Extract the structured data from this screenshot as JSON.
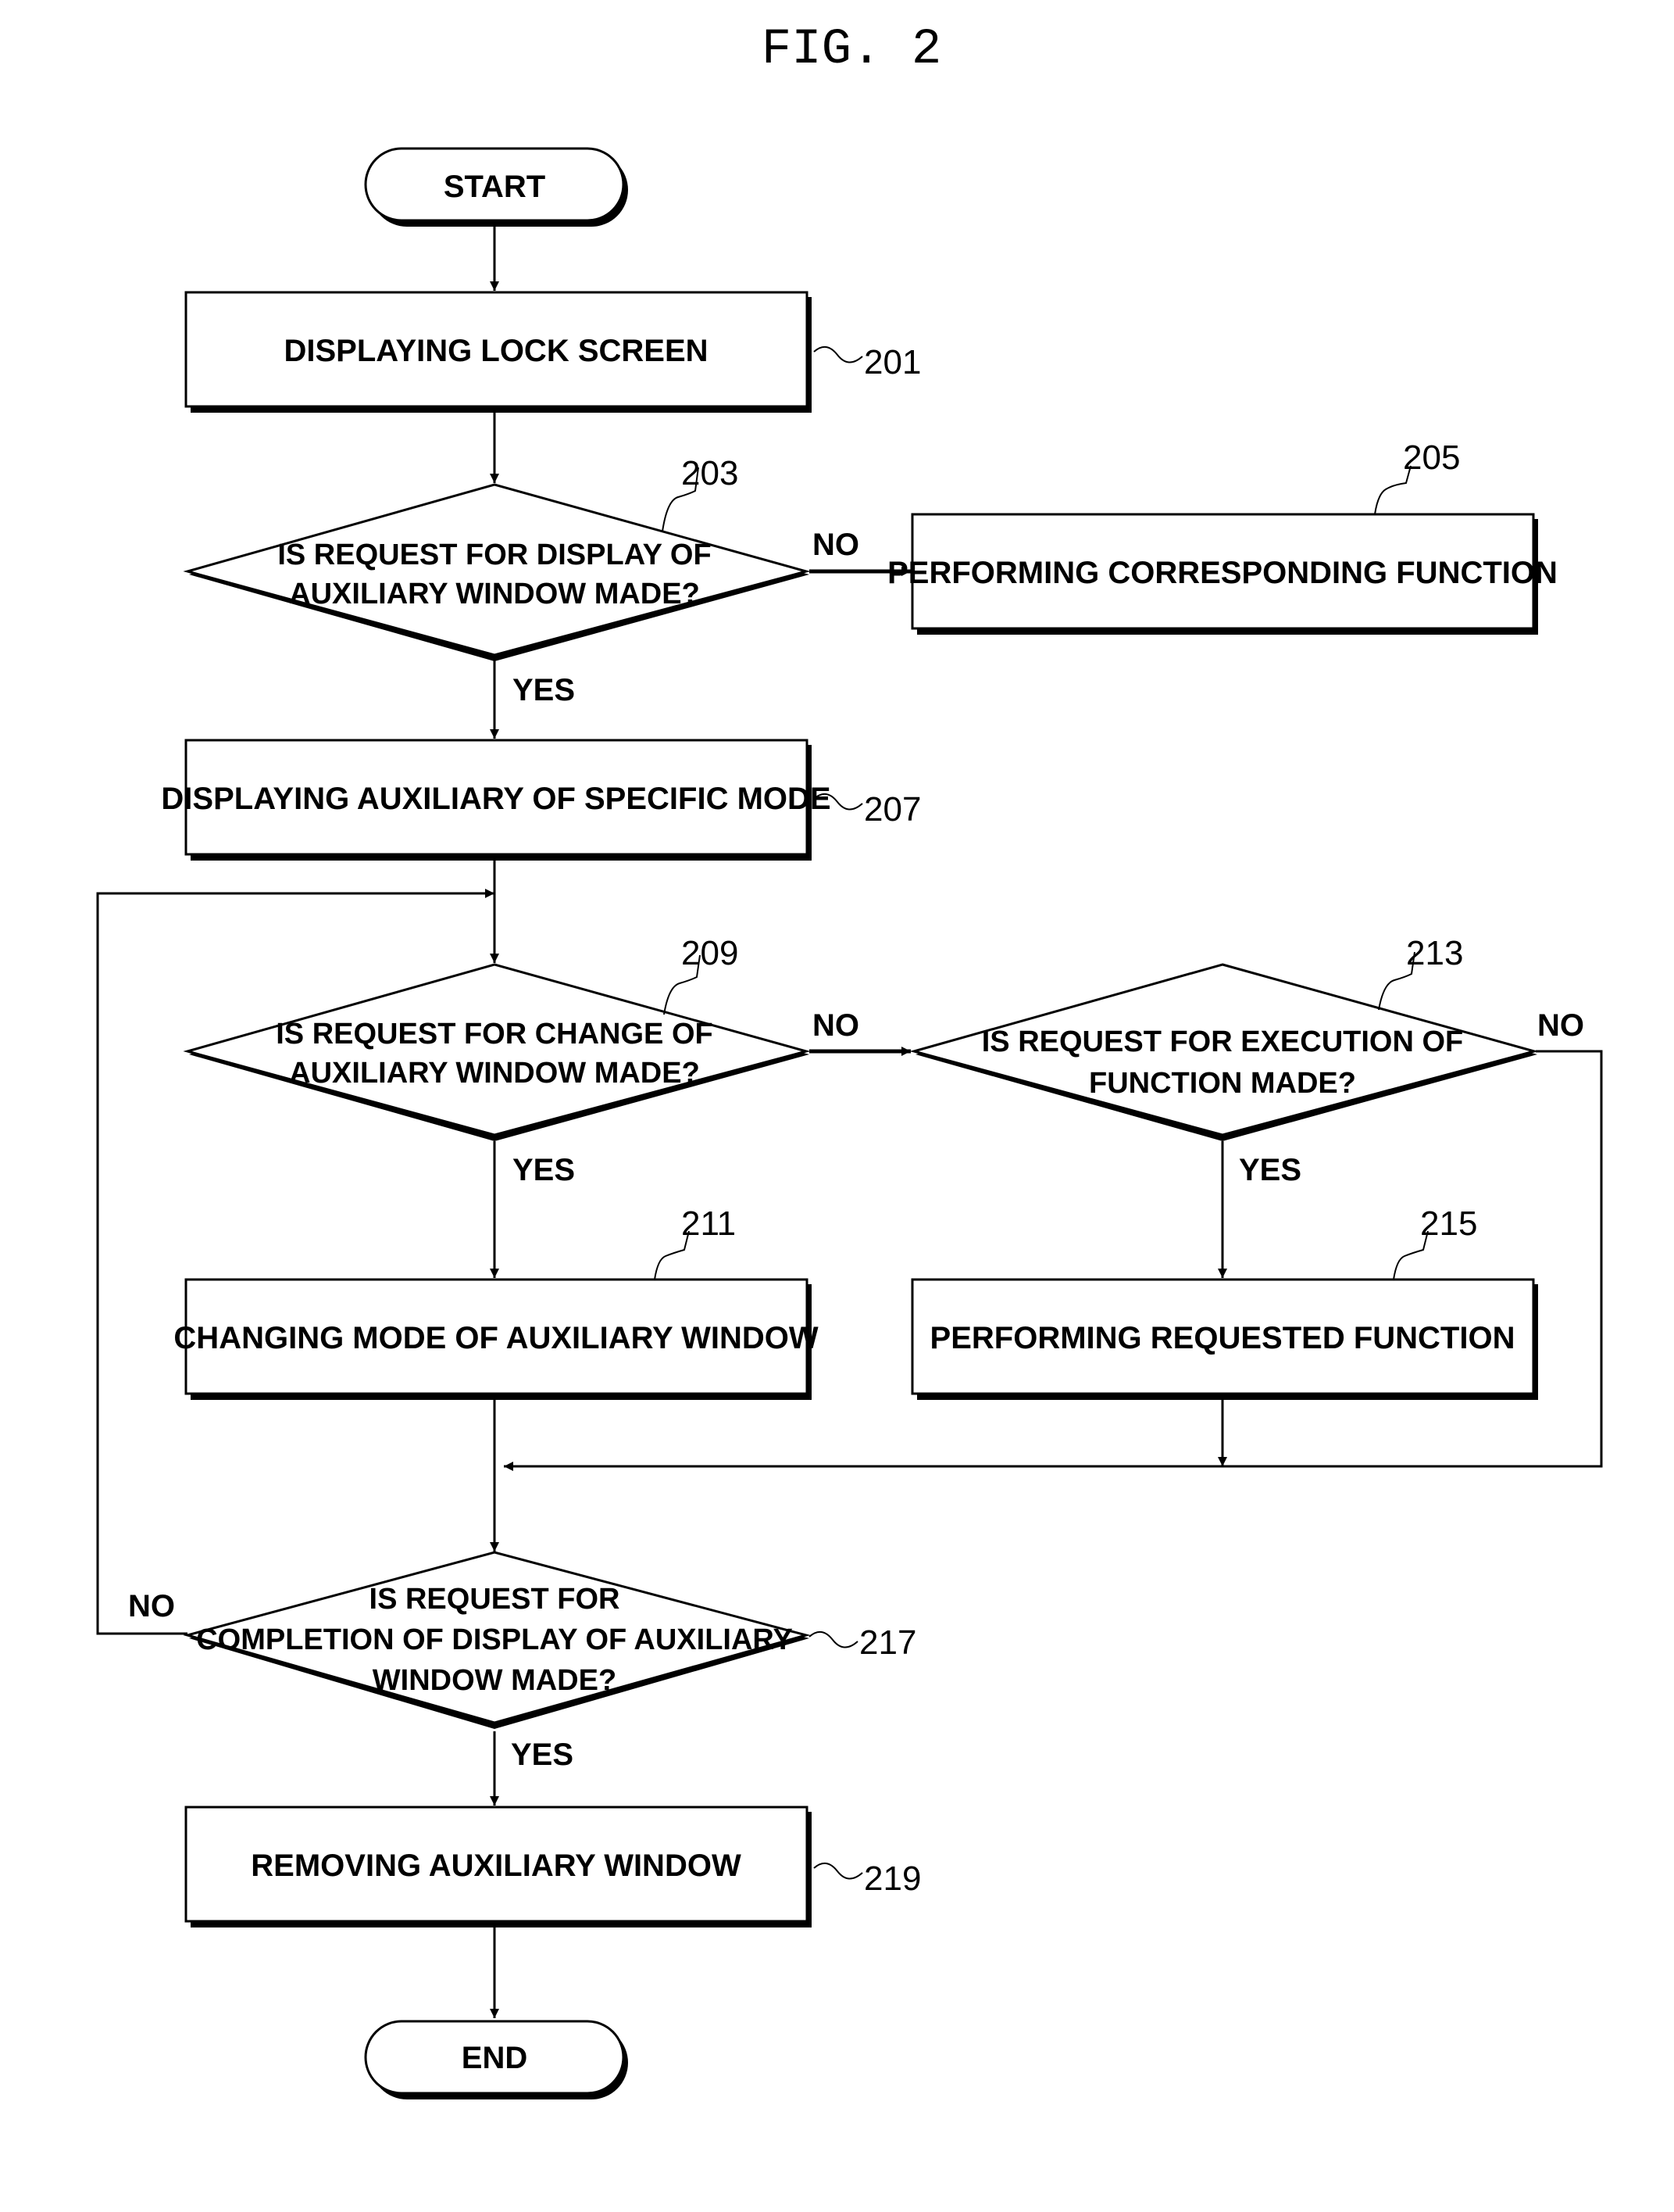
{
  "figure": {
    "title": "FIG. 2"
  },
  "nodes": {
    "start": {
      "label": "START"
    },
    "s201": {
      "ref": "201",
      "lines": [
        "DISPLAYING LOCK SCREEN"
      ]
    },
    "s203": {
      "ref": "203",
      "lines": [
        "IS REQUEST FOR DISPLAY OF",
        "AUXILIARY WINDOW MADE?"
      ]
    },
    "s205": {
      "ref": "205",
      "lines": [
        "PERFORMING CORRESPONDING FUNCTION"
      ]
    },
    "s207": {
      "ref": "207",
      "lines": [
        "DISPLAYING AUXILIARY OF SPECIFIC MODE"
      ]
    },
    "s209": {
      "ref": "209",
      "lines": [
        "IS REQUEST FOR CHANGE OF",
        "AUXILIARY WINDOW MADE?"
      ]
    },
    "s211": {
      "ref": "211",
      "lines": [
        "CHANGING MODE OF AUXILIARY WINDOW"
      ]
    },
    "s213": {
      "ref": "213",
      "lines": [
        "IS REQUEST FOR EXECUTION OF",
        "FUNCTION MADE?"
      ]
    },
    "s215": {
      "ref": "215",
      "lines": [
        "PERFORMING REQUESTED FUNCTION"
      ]
    },
    "s217": {
      "ref": "217",
      "lines": [
        "IS REQUEST FOR",
        "COMPLETION OF DISPLAY OF AUXILIARY",
        "WINDOW MADE?"
      ]
    },
    "s219": {
      "ref": "219",
      "lines": [
        "REMOVING AUXILIARY WINDOW"
      ]
    },
    "end": {
      "label": "END"
    }
  },
  "edge_labels": {
    "s203_no": "NO",
    "s203_yes": "YES",
    "s209_no": "NO",
    "s209_yes": "YES",
    "s213_no": "NO",
    "s213_yes": "YES",
    "s217_no": "NO",
    "s217_yes": "YES"
  }
}
